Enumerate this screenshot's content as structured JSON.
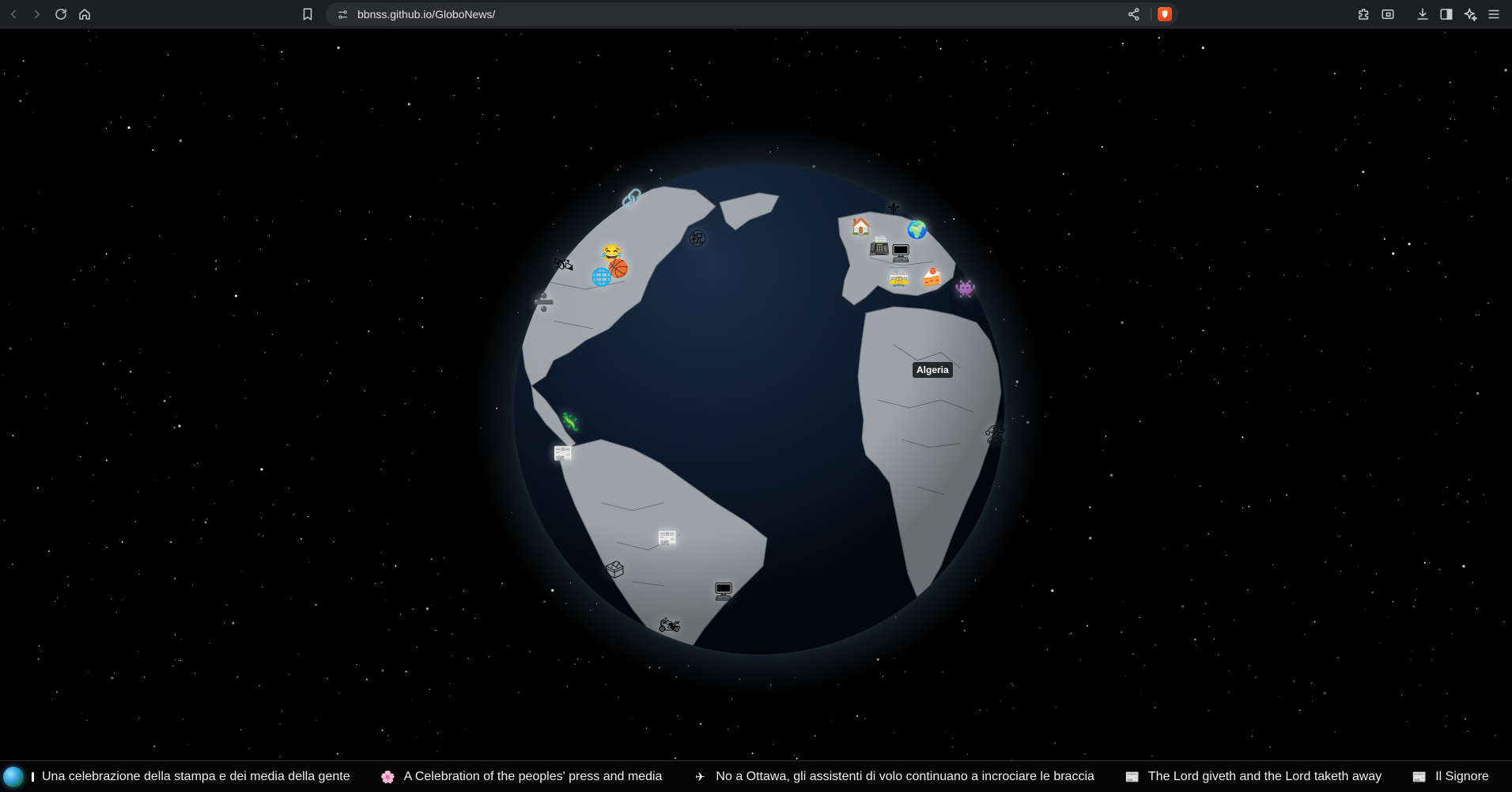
{
  "browser": {
    "url": "bbnss.github.io/GloboNews/",
    "icons": [
      "back-icon",
      "forward-icon",
      "reload-icon",
      "home-icon",
      "bookmark-icon",
      "site-settings-icon",
      "share-icon",
      "brave-shields-icon",
      "extensions-icon",
      "screenshot-icon",
      "download-icon",
      "sidebar-icon",
      "leo-ai-icon",
      "menu-icon"
    ]
  },
  "globe": {
    "hovered_country": "Algeria",
    "ocean_color": "#0b1a2e",
    "land_color": "#9aa1a8",
    "atmosphere_color": "#9fd4ff",
    "markers": [
      {
        "icon": "🔗",
        "name": "marker-link"
      },
      {
        "icon": "㊗",
        "name": "marker-celebration"
      },
      {
        "icon": "🛰",
        "name": "marker-satellite"
      },
      {
        "icon": "😂",
        "name": "marker-laugh"
      },
      {
        "icon": "🏀",
        "name": "marker-basketball"
      },
      {
        "icon": "🌐",
        "name": "marker-globe-west"
      },
      {
        "icon": "➗",
        "name": "marker-divide"
      },
      {
        "icon": "🏠",
        "name": "marker-house"
      },
      {
        "icon": "⚜",
        "name": "marker-fleur-de-lis"
      },
      {
        "icon": "🌍",
        "name": "marker-globe-europe"
      },
      {
        "icon": "📠",
        "name": "marker-fax"
      },
      {
        "icon": "🖥",
        "name": "marker-monitor-europe"
      },
      {
        "icon": "🚋",
        "name": "marker-tram"
      },
      {
        "icon": "🍰",
        "name": "marker-cake"
      },
      {
        "icon": "👾",
        "name": "marker-alien"
      },
      {
        "icon": "🛠",
        "name": "marker-tools"
      },
      {
        "icon": "🦎",
        "name": "marker-lizard"
      },
      {
        "icon": "📰",
        "name": "marker-newspaper-colombia"
      },
      {
        "icon": "📰",
        "name": "marker-newspaper-brazil"
      },
      {
        "icon": "🗳",
        "name": "marker-ballot"
      },
      {
        "icon": "🖥",
        "name": "marker-monitor-brazil"
      },
      {
        "icon": "🏍",
        "name": "marker-motorcycle"
      }
    ]
  },
  "ticker": {
    "items": [
      {
        "icon": "",
        "text": "Una celebrazione della stampa e dei media della gente"
      },
      {
        "icon": "🌸",
        "text": "A Celebration of the peoples' press and media"
      },
      {
        "icon": "✈",
        "text": "No a Ottawa, gli assistenti di volo continuano a incrociare le braccia"
      },
      {
        "icon": "📰",
        "text": "The Lord giveth and the Lord taketh away"
      },
      {
        "icon": "📰",
        "text": "Il Signore"
      }
    ]
  }
}
